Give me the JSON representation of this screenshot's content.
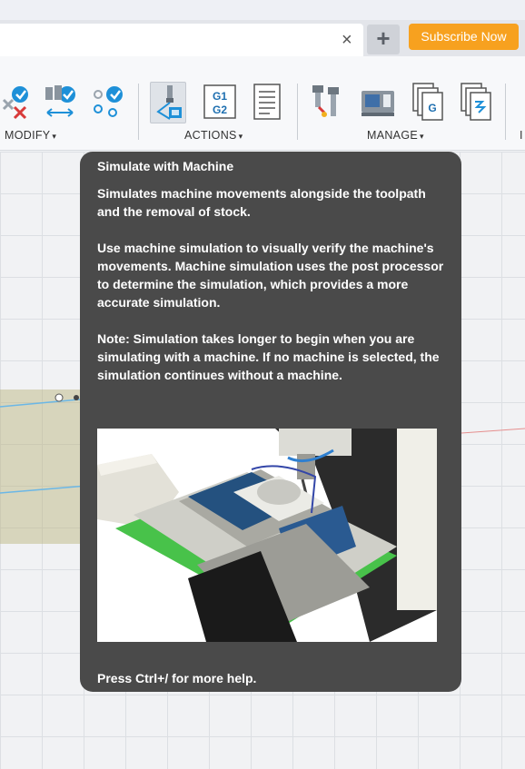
{
  "tabs": {
    "close_glyph": "×",
    "new_tab_glyph": "+",
    "subscribe_label": "Subscribe Now"
  },
  "toolbar": {
    "groups": [
      {
        "label": "MODIFY"
      },
      {
        "label": "ACTIONS"
      },
      {
        "label": "MANAGE"
      }
    ],
    "caret": "▾",
    "g1g2_top": "G1",
    "g1g2_bottom": "G2",
    "g_glyph": "G",
    "trailing_label": "I",
    "accent_blue": "#1e90d8",
    "accent_red": "#d83a3a"
  },
  "tooltip": {
    "title": "Simulate with Machine",
    "para1": "Simulates machine movements alongside the toolpath and the removal of stock.",
    "para2": "Use machine simulation to visually verify the machine's movements. Machine simulation uses the post processor to determine the simulation, which provides a more accurate simulation.",
    "para3": "Note: Simulation takes longer to begin when you are simulating with a machine. If no machine is selected, the simulation continues without a machine.",
    "footer": "Press Ctrl+/ for more help.",
    "background": "#4a4a4a"
  }
}
